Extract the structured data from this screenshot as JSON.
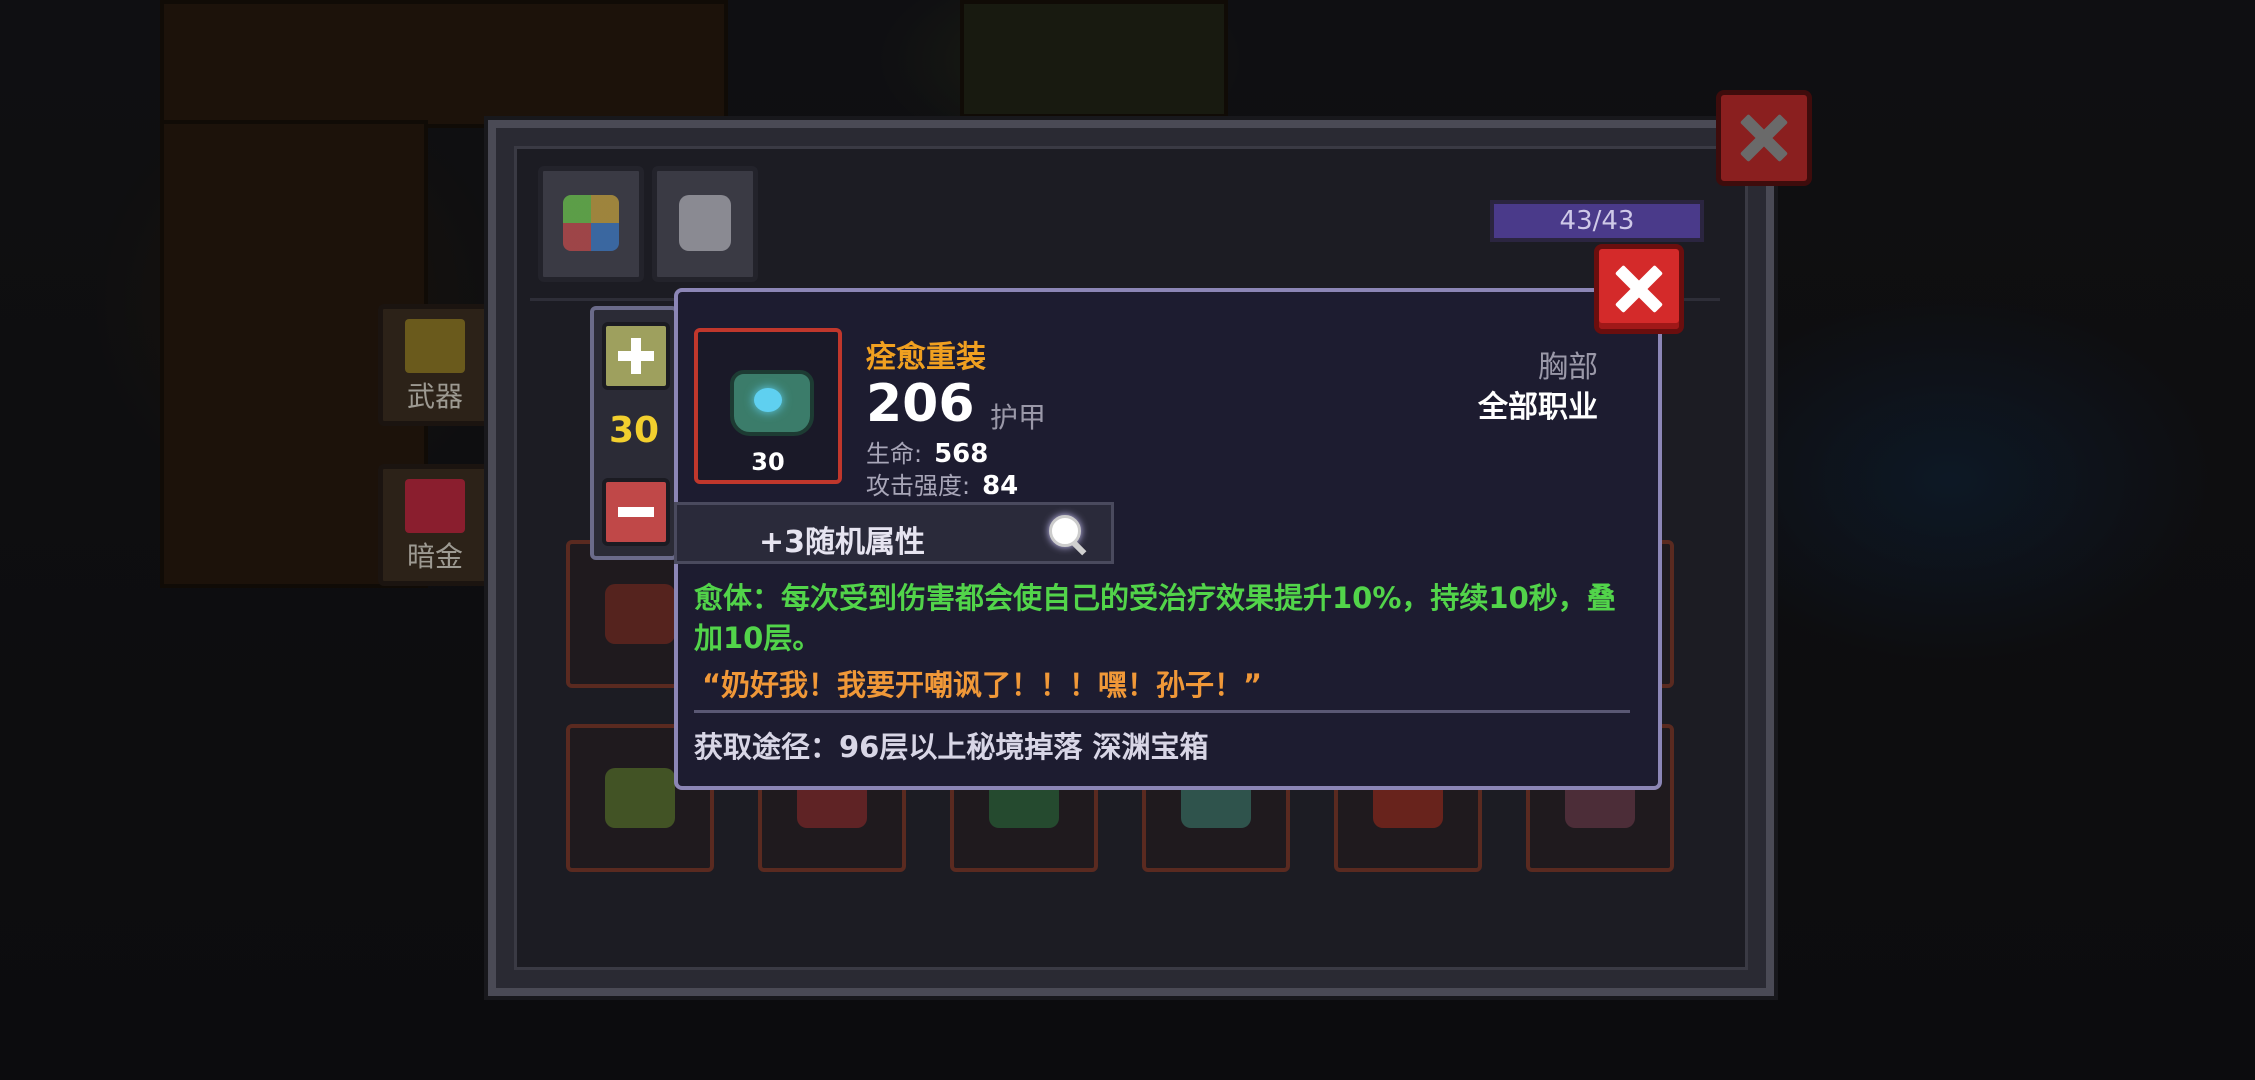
{
  "inventory": {
    "capacity_text": "43/43",
    "side_tabs": [
      {
        "label": "武器"
      },
      {
        "label": "暗金"
      }
    ]
  },
  "quantity": {
    "value": "30"
  },
  "item": {
    "name": "痊愈重装",
    "level": "30",
    "armor_value": "206",
    "armor_label": "护甲",
    "stats": [
      {
        "label": "生命:",
        "value": "568"
      },
      {
        "label": "攻击强度:",
        "value": "84"
      }
    ],
    "slot_type": "胸部",
    "class_requirement": "全部职业",
    "random_affix_text": "+3随机属性",
    "effect_text": "愈体：每次受到伤害都会使自己的受治疗效果提升10%，持续10秒，叠加10层。",
    "flavor_quote": "“奶好我！我要开嘲讽了！！！嘿！孙子！”",
    "source_text": "获取途径：96层以上秘境掉落 深渊宝箱"
  },
  "colors": {
    "item_name": "#f0a020",
    "effect": "#52d44a",
    "quote": "#f09838",
    "quantity": "#f2cf2e",
    "close_button": "#d42a2a"
  },
  "icons": [
    "plus-icon",
    "minus-icon",
    "magnifier-icon",
    "close-icon",
    "chest-armor-icon"
  ]
}
